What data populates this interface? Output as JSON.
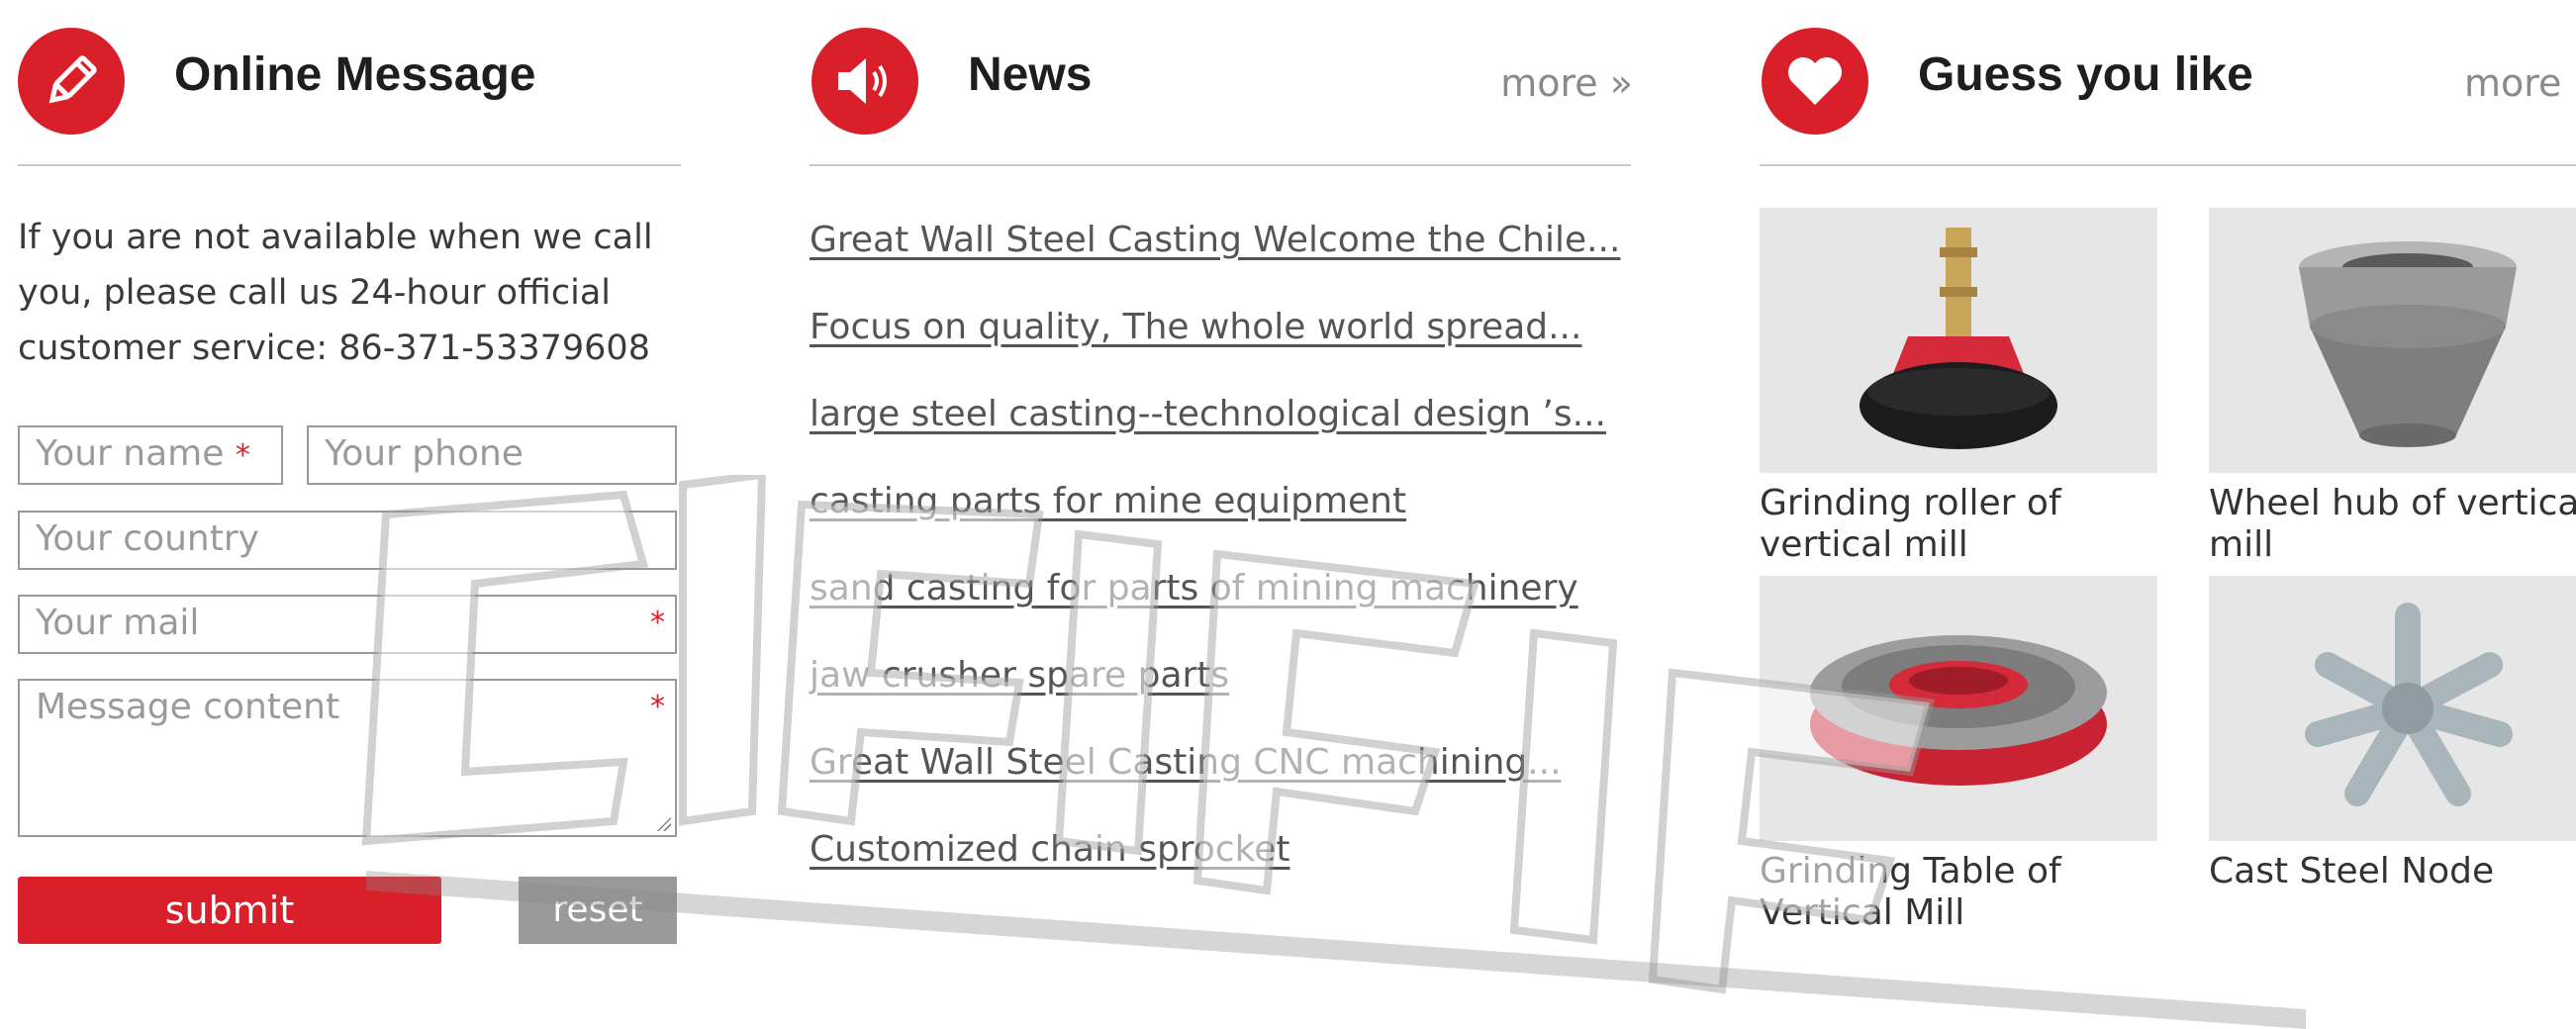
{
  "message": {
    "title": "Online Message",
    "intro": "If you are not available when we call you, please call us 24-hour official customer service: 86-371-53379608",
    "name_placeholder": "Your name",
    "phone_placeholder": "Your phone",
    "country_placeholder": "Your country",
    "mail_placeholder": "Your mail",
    "content_placeholder": "Message content",
    "required_mark": "*",
    "submit_label": "submit",
    "reset_label": "reset"
  },
  "news": {
    "title": "News",
    "more_label": "more »",
    "items": [
      "Great Wall Steel Casting Welcome the Chile...",
      "Focus on quality, The whole world spread...",
      "large steel casting--technological design ’s...",
      "casting parts for mine equipment",
      "sand casting for parts of mining machinery",
      "jaw crusher spare parts",
      "Great Wall Steel Casting CNC machining...",
      "Customized chain sprocket"
    ]
  },
  "like": {
    "title": "Guess you like",
    "more_label": "more »",
    "products": [
      {
        "caption": "Grinding roller of vertical mill",
        "icon": "grinding-roller-image"
      },
      {
        "caption": "Wheel hub of vertical mill",
        "icon": "wheel-hub-image"
      },
      {
        "caption": "Grinding Table of Vertical Mill",
        "icon": "grinding-table-image"
      },
      {
        "caption": "Cast Steel Node",
        "icon": "cast-steel-node-image"
      }
    ]
  },
  "colors": {
    "accent": "#d9202a",
    "rule": "#c8c8c8",
    "reset": "#9a9a9a"
  }
}
